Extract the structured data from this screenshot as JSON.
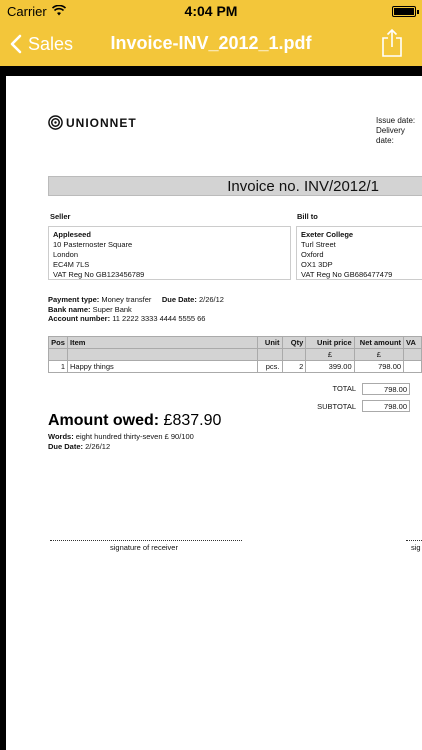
{
  "status_bar": {
    "carrier": "Carrier",
    "time": "4:04 PM"
  },
  "nav": {
    "back_label": "Sales",
    "title": "Invoice-INV_2012_1.pdf"
  },
  "colors": {
    "nav_bar": "#F3C63A",
    "nav_text": "#FFFFFF",
    "table_header": "#D3D3D3"
  },
  "invoice": {
    "logo_text": "UNIONNET",
    "issue_date_label": "Issue date:",
    "delivery_date_label": "Delivery date:",
    "title": "Invoice no. INV/2012/1",
    "seller_label": "Seller",
    "bill_to_label": "Bill to",
    "seller": {
      "name": "Appleseed",
      "line1": "10 Pasternoster Square",
      "line2": "London",
      "line3": "EC4M 7LS",
      "vat": "VAT Reg No GB123456789"
    },
    "bill_to": {
      "name": "Exeter College",
      "line1": "Turl Street",
      "line2": "Oxford",
      "line3": "OX1 3DP",
      "vat": "VAT Reg No GB686477479"
    },
    "payment": {
      "type_label": "Payment type:",
      "type_value": "Money transfer",
      "due_label": "Due Date:",
      "due_value": "2/26/12",
      "bank_label": "Bank name:",
      "bank_value": "Super Bank",
      "account_label": "Account number:",
      "account_value": "11 2222 3333 4444 5555 66"
    },
    "table": {
      "headers": {
        "pos": "Pos",
        "item": "Item",
        "unit": "Unit",
        "qty": "Qty",
        "unit_price": "Unit price",
        "net_amount": "Net amount",
        "vat": "VA"
      },
      "currency_row": {
        "unit_price": "£",
        "net_amount": "£"
      },
      "rows": [
        {
          "pos": "1",
          "item": "Happy things",
          "unit": "pcs.",
          "qty": "2",
          "unit_price": "399.00",
          "net_amount": "798.00"
        }
      ]
    },
    "totals": {
      "total_label": "TOTAL",
      "total_value": "798.00",
      "subtotal_label": "SUBTOTAL",
      "subtotal_value": "798.00"
    },
    "amount_owed_label": "Amount owed:",
    "amount_owed_value": "£837.90",
    "words_label": "Words:",
    "words_value": "eight hundred thirty-seven £ 90/100",
    "due_date_label": "Due Date:",
    "due_date_value": "2/26/12",
    "signature_receiver": "signature of receiver",
    "signature_other": "sig"
  }
}
